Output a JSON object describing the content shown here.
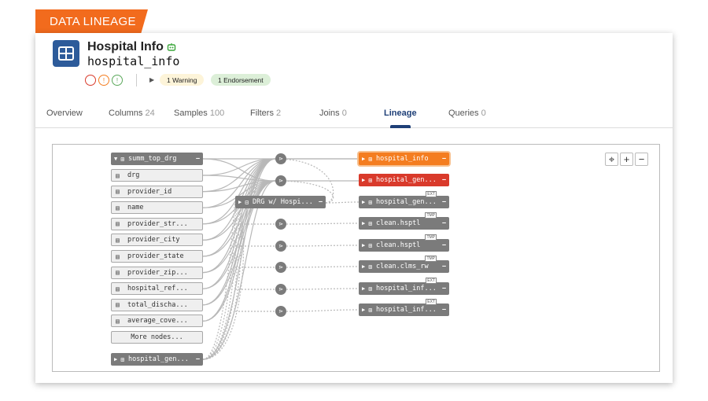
{
  "banner": "DATA LINEAGE",
  "header": {
    "title": "Hospital Info",
    "subtitle": "hospital_info",
    "circles": [
      {
        "label": "",
        "color": "#d93a2b"
      },
      {
        "label": "!",
        "color": "#f47d20"
      },
      {
        "label": "!",
        "color": "#5aa85a"
      }
    ],
    "warning_badge": "1 Warning",
    "endorsement_badge": "1 Endorsement"
  },
  "tabs": [
    {
      "label": "Overview",
      "count": ""
    },
    {
      "label": "Columns",
      "count": "24"
    },
    {
      "label": "Samples",
      "count": "100"
    },
    {
      "label": "Filters",
      "count": "2"
    },
    {
      "label": "Joins",
      "count": "0"
    },
    {
      "label": "Lineage",
      "count": ""
    },
    {
      "label": "Queries",
      "count": "0"
    }
  ],
  "lineage": {
    "source_table": "summ_top_drg",
    "columns": [
      "drg",
      "provider_id",
      "name",
      "provider_str...",
      "provider_city",
      "provider_state",
      "provider_zip...",
      "hospital_ref...",
      "total_discha...",
      "average_cove..."
    ],
    "more_nodes": "More nodes...",
    "bottom_table": "hospital_gen...",
    "query_node": "DRG w/ Hospi...",
    "targets": [
      {
        "label": "hospital_info",
        "tag": "",
        "color": "orange"
      },
      {
        "label": "hospital_gen...",
        "tag": "",
        "color": "red"
      },
      {
        "label": "hospital_gen...",
        "tag": "EXT",
        "color": "gray"
      },
      {
        "label": "clean.hsptl",
        "tag": "TMP",
        "color": "gray"
      },
      {
        "label": "clean.hsptl",
        "tag": "TMP",
        "color": "gray"
      },
      {
        "label": "clean.clms_rw",
        "tag": "TMP",
        "color": "gray"
      },
      {
        "label": "hospital_inf...",
        "tag": "EXT",
        "color": "gray"
      },
      {
        "label": "hospital_inf...",
        "tag": "EXT",
        "color": "gray"
      }
    ],
    "zoom": [
      "recenter-icon",
      "zoom-in-icon",
      "zoom-out-icon"
    ]
  }
}
